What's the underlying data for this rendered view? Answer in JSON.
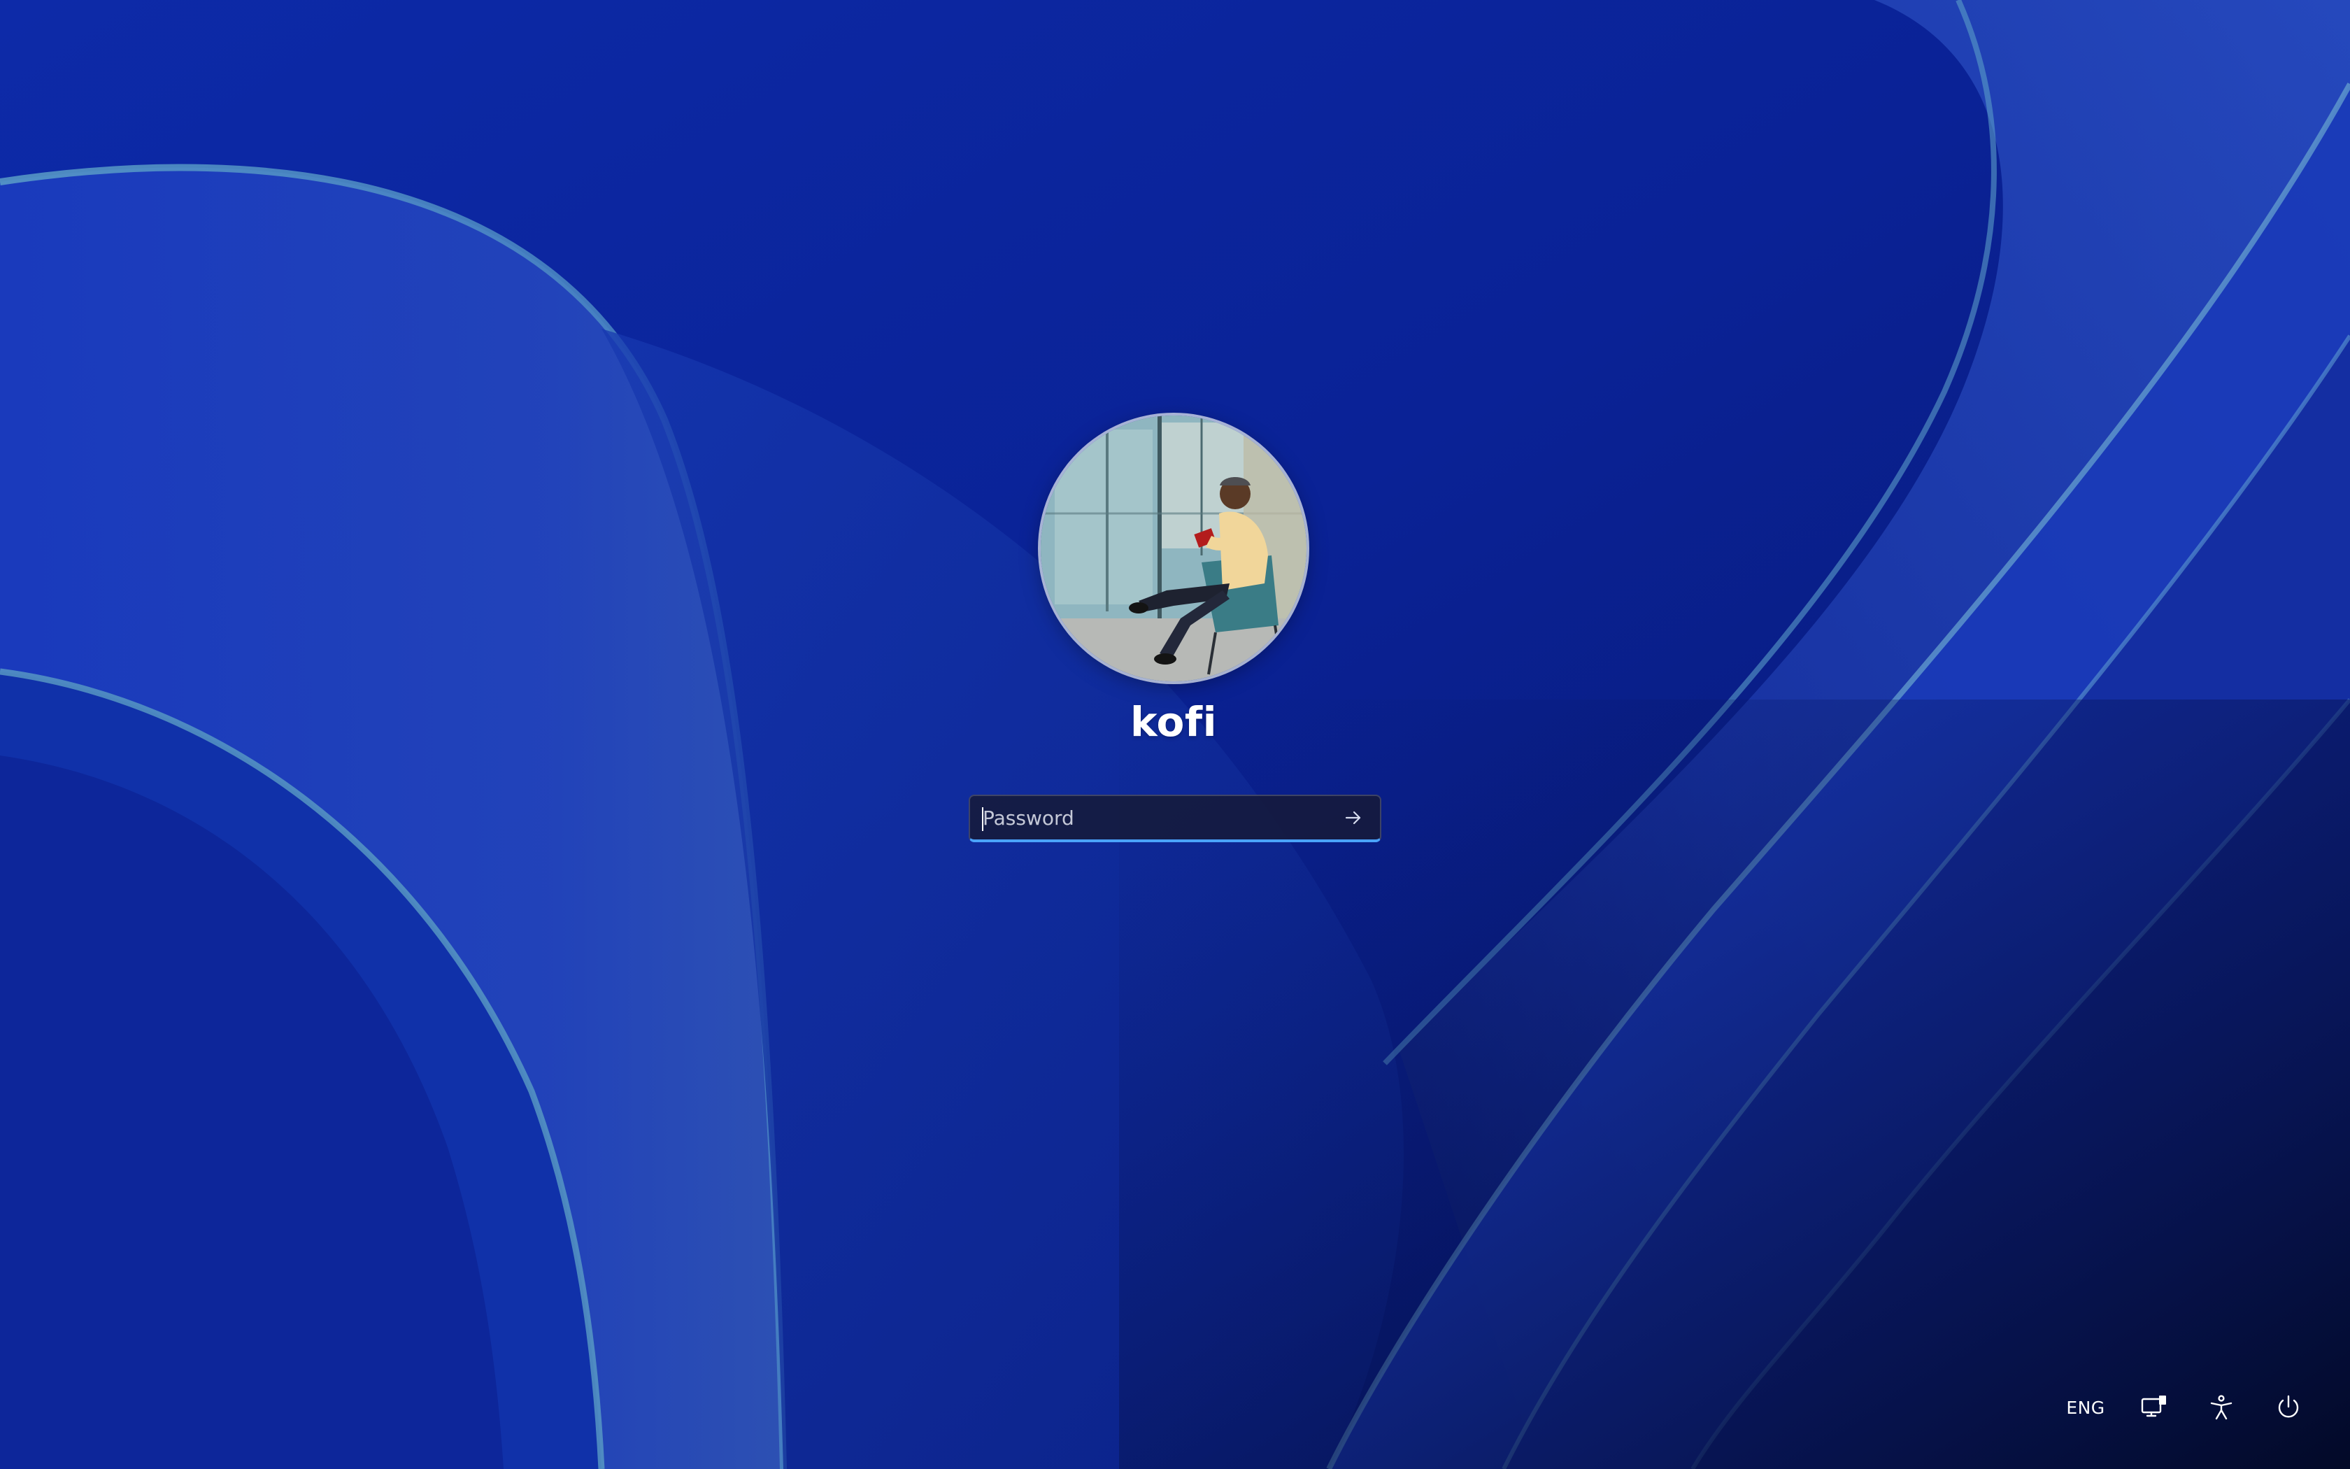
{
  "login": {
    "username": "kofi",
    "password_placeholder": "Password",
    "password_value": ""
  },
  "tray": {
    "language": "ENG",
    "icons": [
      "network-icon",
      "accessibility-icon",
      "power-icon"
    ]
  },
  "colors": {
    "background": "#0b2397",
    "accent": "#4aa3ff",
    "field_background": "#161a3a",
    "text": "#ffffff"
  }
}
